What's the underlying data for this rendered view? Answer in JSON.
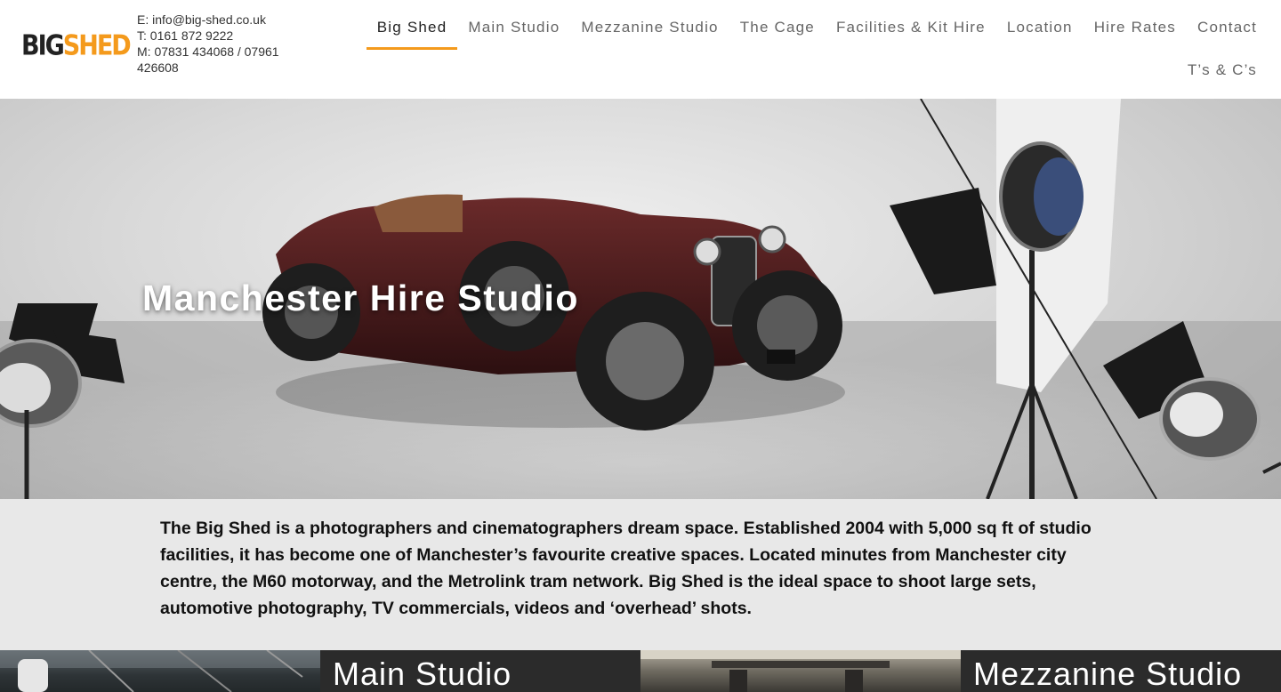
{
  "brand": {
    "logo_big": "BIG",
    "logo_shed": "SHED",
    "accent": "#f49a1c"
  },
  "contact": {
    "email": "E: info@big-shed.co.uk",
    "phone": "T: 0161 872 9222",
    "mobile": "M: 07831 434068 / 07961 426608"
  },
  "nav": {
    "items": [
      {
        "label": "Big Shed",
        "active": true
      },
      {
        "label": "Main Studio"
      },
      {
        "label": "Mezzanine Studio"
      },
      {
        "label": "The Cage"
      },
      {
        "label": "Facilities & Kit Hire"
      },
      {
        "label": "Location"
      },
      {
        "label": "Hire Rates"
      },
      {
        "label": "Contact"
      }
    ],
    "row2": [
      {
        "label": "T’s & C’s"
      }
    ]
  },
  "hero": {
    "title": "Manchester Hire Studio"
  },
  "intro": {
    "text": "The Big Shed is a photographers and cinematographers dream space. Established 2004 with 5,000 sq ft of studio facilities, it has become one of Manchester’s favourite creative spaces. Located minutes from Manchester city centre, the M60 motorway, and the Metrolink tram network. Big Shed is the ideal space to shoot large sets, automotive photography, TV commercials, videos and ‘overhead’ shots."
  },
  "tiles": [
    {
      "label": "Main Studio"
    },
    {
      "label": "Mezzanine Studio"
    }
  ]
}
